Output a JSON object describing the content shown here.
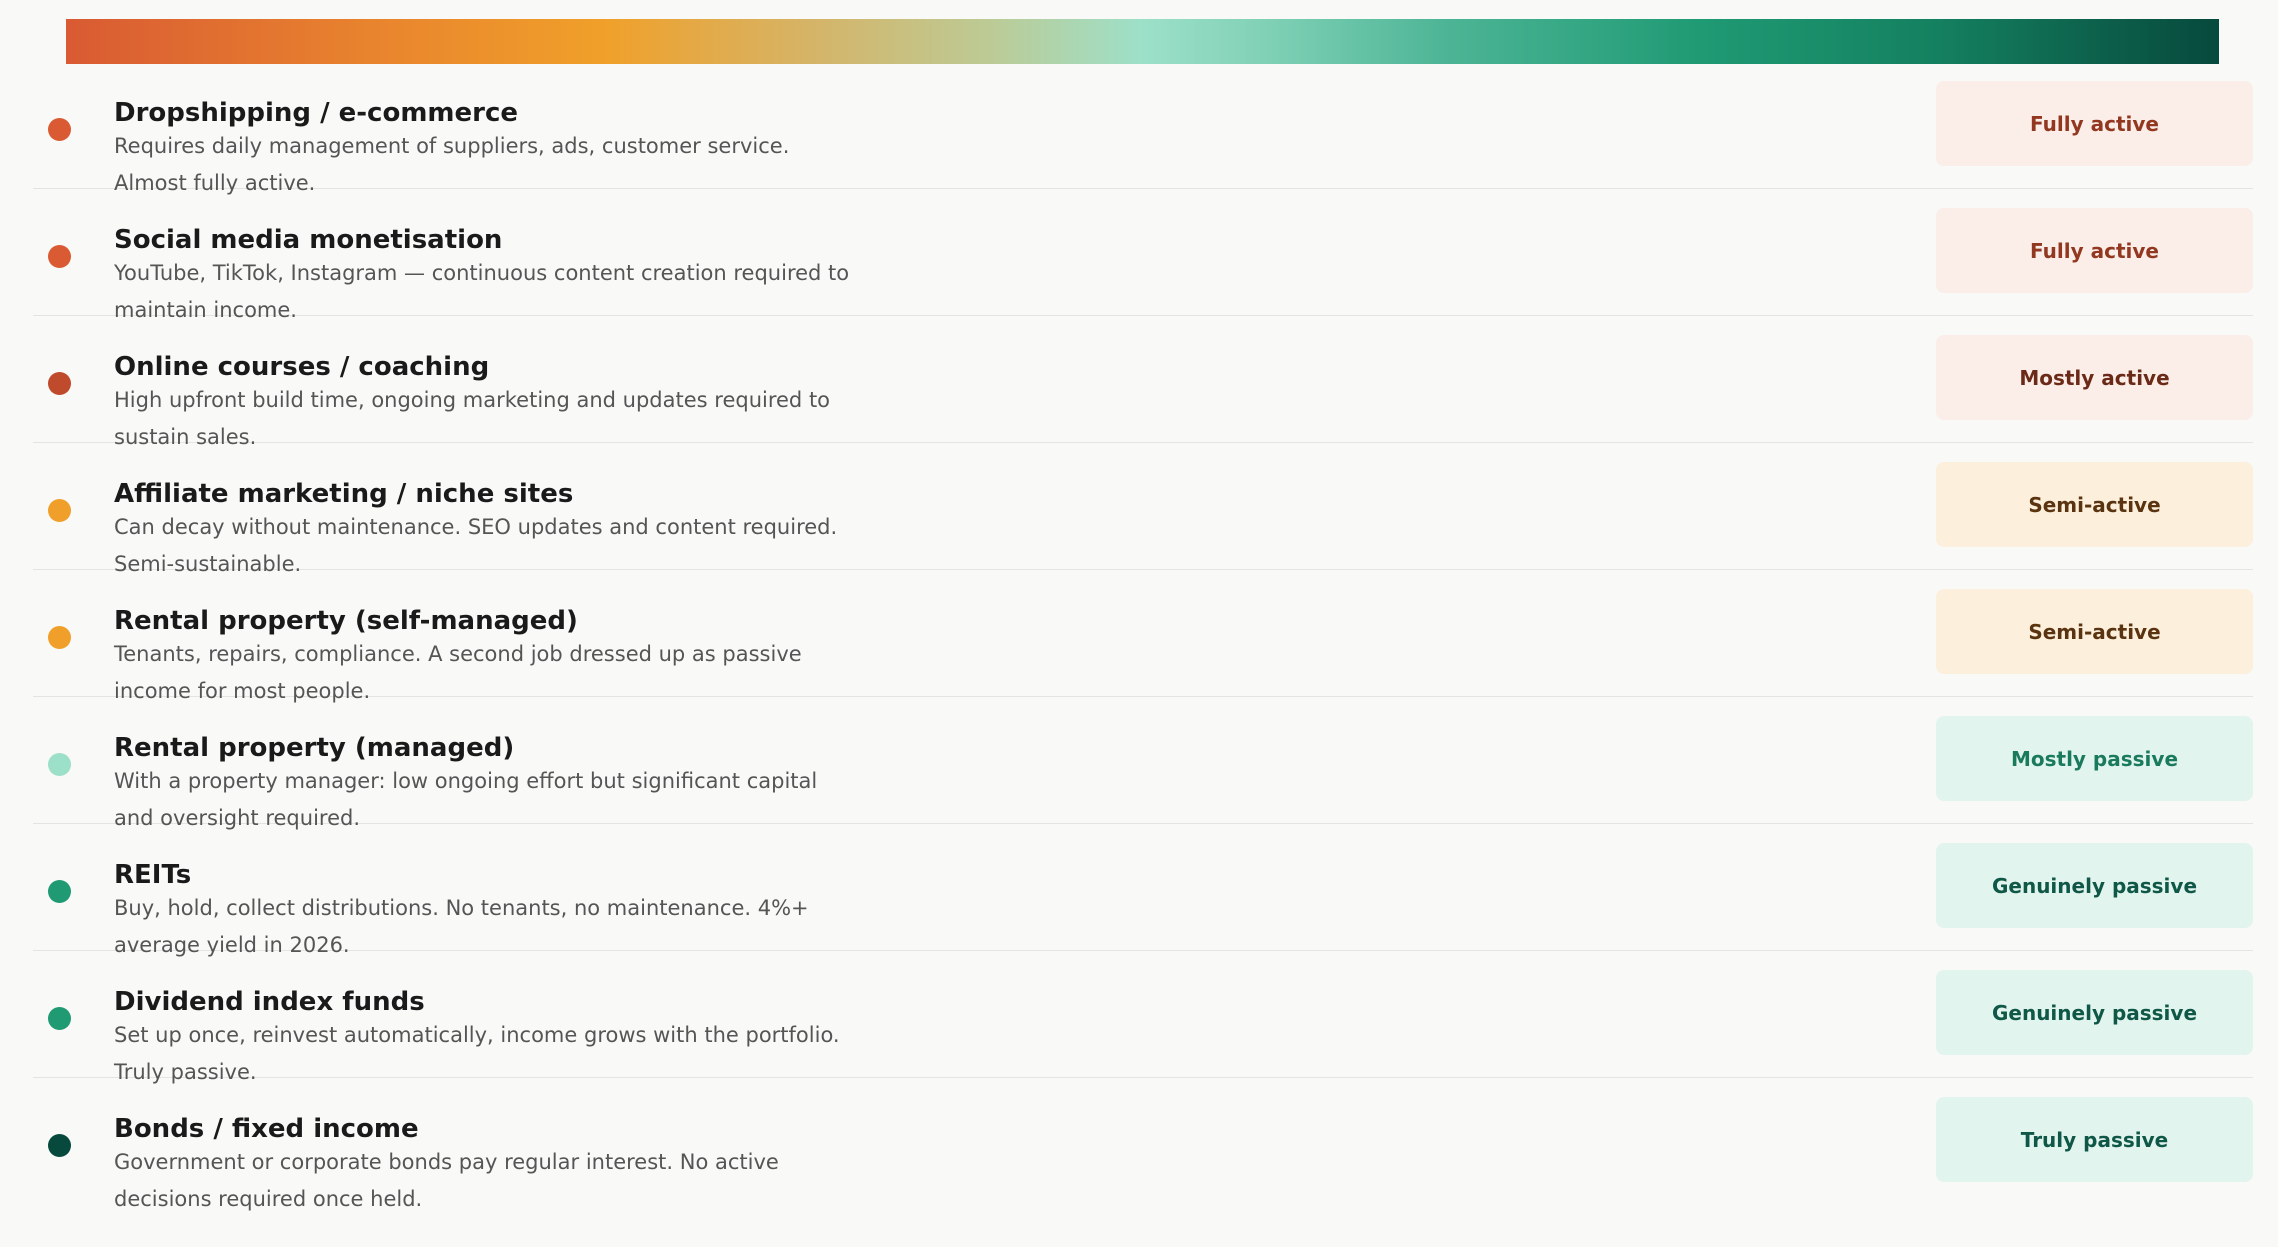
{
  "items": [
    {
      "title": "Dropshipping / e-commerce",
      "description": "Requires daily management of suppliers, ads, customer service. Almost fully active.",
      "badge": "Fully active",
      "dot_color": "#d95a33",
      "badge_bg": "#fbede8",
      "badge_color": "#923820"
    },
    {
      "title": "Social media monetisation",
      "description": "YouTube, TikTok, Instagram — continuous content creation required to maintain income.",
      "badge": "Fully active",
      "dot_color": "#d95a33",
      "badge_bg": "#fbede8",
      "badge_color": "#923820"
    },
    {
      "title": "Online courses / coaching",
      "description": "High upfront build time, ongoing marketing and updates required to sustain sales.",
      "badge": "Mostly active",
      "dot_color": "#c04a2c",
      "badge_bg": "#fbede8",
      "badge_color": "#6b2a18"
    },
    {
      "title": "Affiliate marketing / niche sites",
      "description": "Can decay without maintenance. SEO updates and content required. Semi-sustainable.",
      "badge": "Semi-active",
      "dot_color": "#f0a02a",
      "badge_bg": "#fcefdc",
      "badge_color": "#5a3410"
    },
    {
      "title": "Rental property (self-managed)",
      "description": "Tenants, repairs, compliance. A second job dressed up as passive income for most people.",
      "badge": "Semi-active",
      "dot_color": "#f0a02a",
      "badge_bg": "#fcefdc",
      "badge_color": "#5a3410"
    },
    {
      "title": "Rental property (managed)",
      "description": "With a property manager: low ongoing effort but significant capital and oversight required.",
      "badge": "Mostly passive",
      "dot_color": "#9de0c9",
      "badge_bg": "#e2f4ee",
      "badge_color": "#1a7a5c"
    },
    {
      "title": "REITs",
      "description": "Buy, hold, collect distributions. No tenants, no maintenance. 4%+ average yield in 2026.",
      "badge": "Genuinely passive",
      "dot_color": "#1f9a73",
      "badge_bg": "#e2f4ee",
      "badge_color": "#0f5746"
    },
    {
      "title": "Dividend index funds",
      "description": "Set up once, reinvest automatically, income grows with the portfolio. Truly passive.",
      "badge": "Genuinely passive",
      "dot_color": "#1f9a73",
      "badge_bg": "#e2f4ee",
      "badge_color": "#0f5746"
    },
    {
      "title": "Bonds / fixed income",
      "description": "Government or corporate bonds pay regular interest. No active decisions required once held.",
      "badge": "Truly passive",
      "dot_color": "#07493d",
      "badge_bg": "#e2f4ee",
      "badge_color": "#0f5746"
    }
  ]
}
